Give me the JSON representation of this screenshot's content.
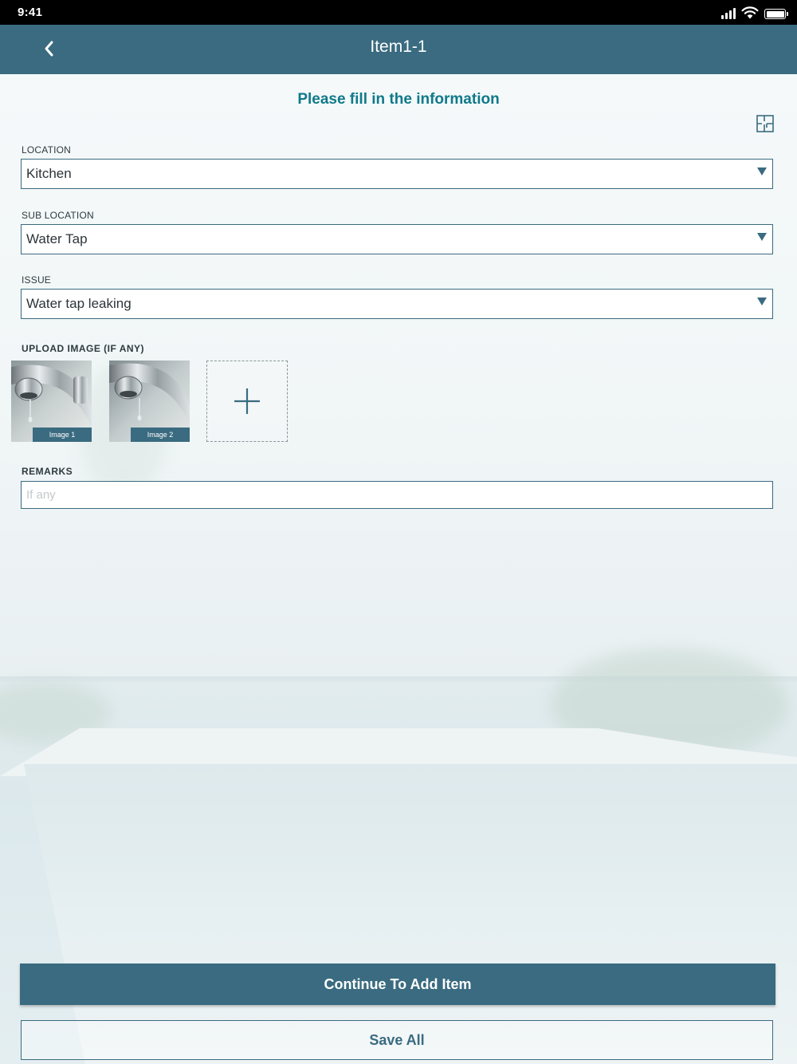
{
  "status_bar": {
    "time": "9:41"
  },
  "nav": {
    "title": "Item1-1"
  },
  "form": {
    "heading": "Please fill in the information",
    "location": {
      "label": "LOCATION",
      "value": "Kitchen"
    },
    "sub_location": {
      "label": "SUB LOCATION",
      "value": "Water Tap"
    },
    "issue": {
      "label": "ISSUE",
      "value": "Water tap leaking"
    },
    "upload": {
      "label": "UPLOAD IMAGE (IF ANY)",
      "images": [
        {
          "caption": "Image 1"
        },
        {
          "caption": "Image 2"
        }
      ]
    },
    "remarks": {
      "label": "REMARKS",
      "placeholder": "If any",
      "value": ""
    }
  },
  "actions": {
    "continue_label": "Continue To Add Item",
    "save_label": "Save All"
  },
  "colors": {
    "primary": "#3a6b80",
    "heading": "#0f7a8a",
    "status_bar": "#000000"
  },
  "icons": {
    "back": "chevron-left-icon",
    "floorplan": "floorplan-icon",
    "dropdown": "caret-down-icon",
    "add": "plus-icon"
  }
}
